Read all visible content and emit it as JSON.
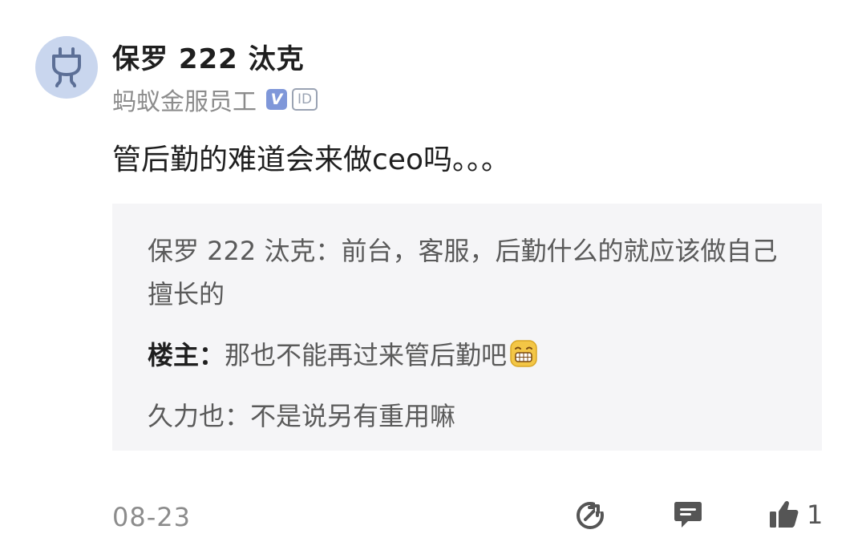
{
  "comment": {
    "username": "保罗 222 汰克",
    "company": "蚂蚁金服员工",
    "badge_v": "V",
    "badge_id": "ID",
    "text": "管后勤的难道会来做ceo吗。。。",
    "date": "08-23",
    "like_count": "1"
  },
  "replies": [
    {
      "author": "保罗 222 汰克：",
      "content": "前台，客服，后勤什么的就应该做自己擅长的",
      "is_op": false
    },
    {
      "author": "楼主：",
      "content": "那也不能再过来管后勤吧",
      "is_op": true,
      "emoji": "grinning-emoji"
    },
    {
      "author": "久力也：",
      "content": "不是说另有重用嘛",
      "is_op": false
    }
  ],
  "icons": {
    "avatar": "plug-icon",
    "share": "share-icon",
    "comment": "comment-icon",
    "like": "thumbs-up-icon"
  },
  "colors": {
    "avatar_bg": "#c9d6ee",
    "badge_v": "#7f97d9",
    "reply_box_bg": "#f5f5f7",
    "icon": "#555555"
  }
}
